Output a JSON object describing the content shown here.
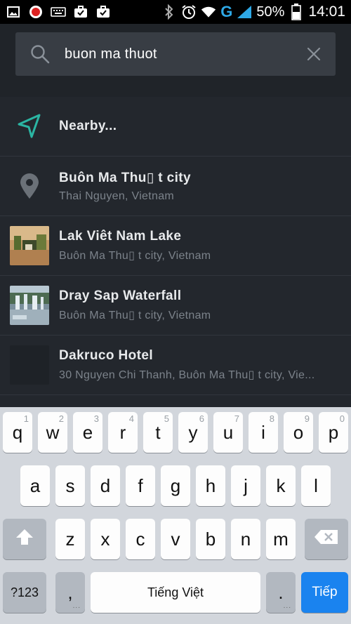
{
  "status_bar": {
    "battery_percent": "50%",
    "time": "14:01",
    "network_letter": "G"
  },
  "search": {
    "query": "buon ma thuot"
  },
  "results": [
    {
      "title": "Nearby...",
      "subtitle": "",
      "lead": "navigation-arrow-icon"
    },
    {
      "title": "Buôn Ma Thu▯ t city",
      "subtitle": "Thai Nguyen, Vietnam",
      "lead": "map-pin-icon"
    },
    {
      "title": "Lak Viêt Nam Lake",
      "subtitle": "Buôn Ma Thu▯ t city, Vietnam",
      "lead": "thumbnail"
    },
    {
      "title": "Dray Sap Waterfall",
      "subtitle": "Buôn Ma Thu▯ t city, Vietnam",
      "lead": "thumbnail"
    },
    {
      "title": "Dakruco Hotel",
      "subtitle": "30 Nguyen Chi Thanh, Buôn Ma Thu▯ t city, Vie...",
      "lead": "thumbnail"
    }
  ],
  "keyboard": {
    "row1": [
      {
        "k": "q",
        "h": "1"
      },
      {
        "k": "w",
        "h": "2"
      },
      {
        "k": "e",
        "h": "3"
      },
      {
        "k": "r",
        "h": "4"
      },
      {
        "k": "t",
        "h": "5"
      },
      {
        "k": "y",
        "h": "6"
      },
      {
        "k": "u",
        "h": "7"
      },
      {
        "k": "i",
        "h": "8"
      },
      {
        "k": "o",
        "h": "9"
      },
      {
        "k": "p",
        "h": "0"
      }
    ],
    "row2": [
      "a",
      "s",
      "d",
      "f",
      "g",
      "h",
      "j",
      "k",
      "l"
    ],
    "row3": [
      "z",
      "x",
      "c",
      "v",
      "b",
      "n",
      "m"
    ],
    "symbols_label": "?123",
    "comma_label": ",",
    "space_label": "Tiếng Việt",
    "period_label": ".",
    "enter_label": "Tiếp"
  }
}
